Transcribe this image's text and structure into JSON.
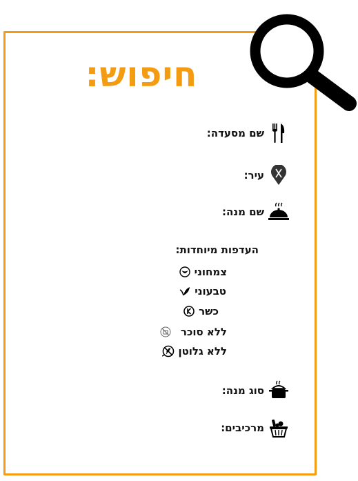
{
  "title": "חיפוש:",
  "fields": {
    "restaurant_name": {
      "label": "שם מסעדה:",
      "icon": "utensils-icon"
    },
    "city": {
      "label": "עיר:",
      "icon": "map-pin-icon"
    },
    "dish_name": {
      "label": "שם מנה:",
      "icon": "cloche-icon"
    },
    "dish_type": {
      "label": "סוג מנה:",
      "icon": "cooking-pot-icon"
    },
    "ingredients": {
      "label": "מרכיבים:",
      "icon": "grocery-basket-icon"
    }
  },
  "preferences": {
    "header": "העדפות מיוחדות:",
    "items": [
      {
        "label": "צמחוני",
        "icon": "vegetarian-icon"
      },
      {
        "label": "טבעוני",
        "icon": "vegan-leaf-icon"
      },
      {
        "label": "כשר",
        "icon": "kosher-icon"
      },
      {
        "label": "ללא סוכר",
        "icon": "no-sugar-icon"
      },
      {
        "label": "ללא גלוטן",
        "icon": "gluten-free-icon"
      }
    ]
  },
  "colors": {
    "accent": "#f39c12",
    "text": "#111111"
  }
}
